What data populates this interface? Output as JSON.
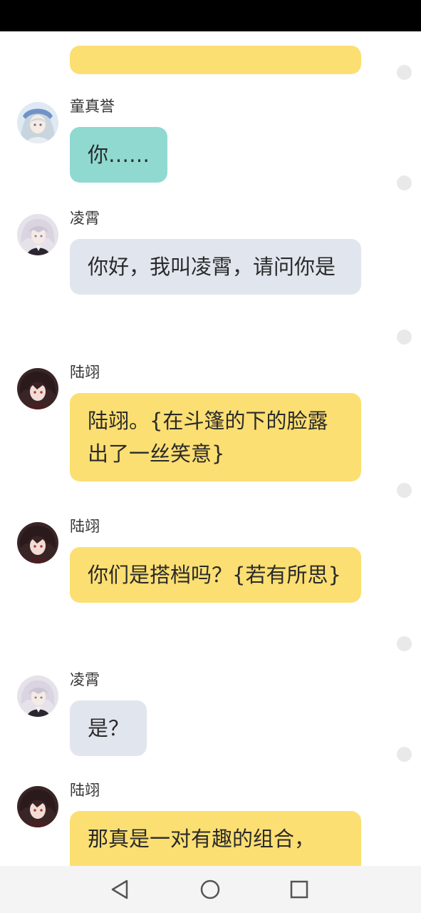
{
  "messages": [
    {
      "sender": "童真誉",
      "text": "你……",
      "avatar_icon": "girl-avatar-icon",
      "bubble_color": "#8fd9d0"
    },
    {
      "sender": "凌霄",
      "text": "你好，我叫凌霄，请问你是",
      "avatar_icon": "white-hair-boy-avatar-icon",
      "bubble_color": "#e1e6ee"
    },
    {
      "sender": "陆翊",
      "text": "陆翊。{在斗篷的下的脸露出了一丝笑意}",
      "avatar_icon": "dark-hair-boy-avatar-icon",
      "bubble_color": "#fcdf72"
    },
    {
      "sender": "陆翊",
      "text": "你们是搭档吗？{若有所思}",
      "avatar_icon": "dark-hair-boy-avatar-icon",
      "bubble_color": "#fcdf72"
    },
    {
      "sender": "凌霄",
      "text": "是？",
      "avatar_icon": "white-hair-boy-avatar-icon",
      "bubble_color": "#e1e6ee"
    },
    {
      "sender": "陆翊",
      "text": "那真是一对有趣的组合，",
      "avatar_icon": "dark-hair-boy-avatar-icon",
      "bubble_color": "#fcdf72"
    }
  ],
  "nav": {
    "back_icon": "back-triangle-icon",
    "home_icon": "home-circle-icon",
    "recents_icon": "recents-square-icon"
  }
}
